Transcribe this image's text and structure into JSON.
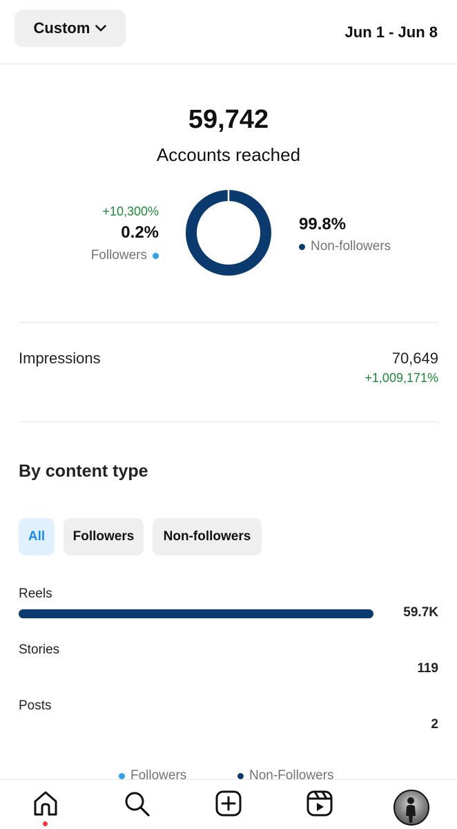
{
  "header": {
    "range_selector_label": "Custom",
    "date_range": "Jun 1 - Jun 8"
  },
  "reach": {
    "total": "59,742",
    "label": "Accounts reached",
    "followers": {
      "change": "+10,300%",
      "percent": "0.2%",
      "label": "Followers",
      "color": "#2ea2ee",
      "share": 0.002
    },
    "non_followers": {
      "percent": "99.8%",
      "label": "Non-followers",
      "color": "#0b3a6e",
      "share": 0.998
    }
  },
  "impressions": {
    "label": "Impressions",
    "value": "70,649",
    "change": "+1,009,171%"
  },
  "content_type": {
    "title": "By content type",
    "filters": [
      "All",
      "Followers",
      "Non-followers"
    ],
    "selected_filter": "All",
    "rows": [
      {
        "label": "Reels",
        "value": "59.7K",
        "share": 1.0
      },
      {
        "label": "Stories",
        "value": "119",
        "share": 0.002
      },
      {
        "label": "Posts",
        "value": "2",
        "share": 0.0
      }
    ],
    "legend": [
      "Followers",
      "Non-Followers"
    ]
  },
  "bottom_nav": {
    "items": [
      "home-icon",
      "search-icon",
      "create-icon",
      "reels-icon",
      "profile-avatar"
    ],
    "active": "home-icon",
    "notification_color": "#ff3040"
  }
}
